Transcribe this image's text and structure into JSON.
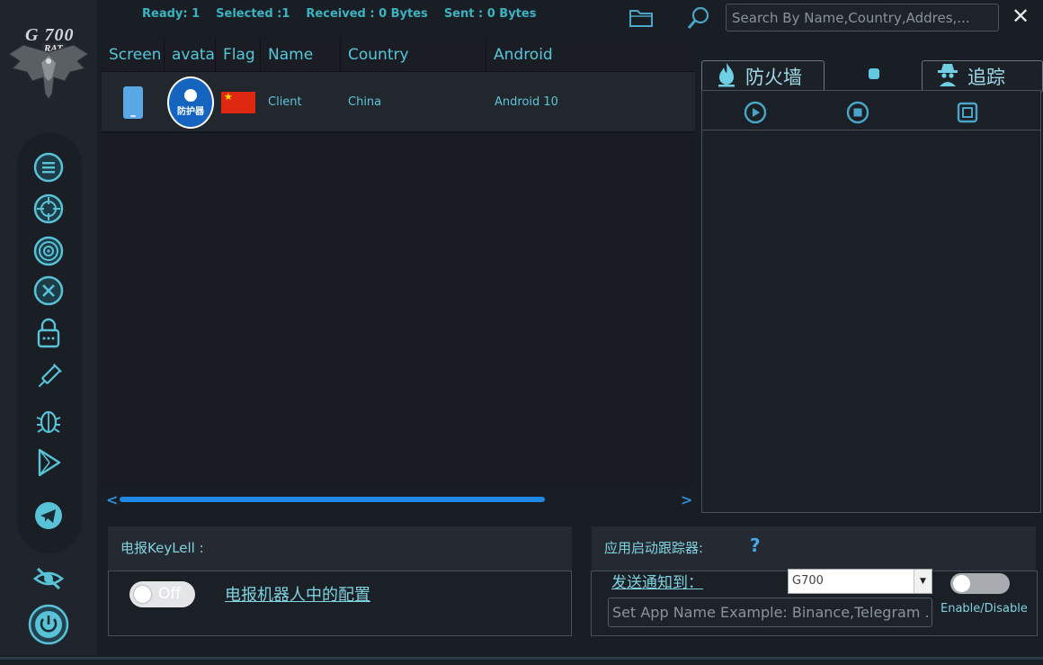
{
  "logo": {
    "title": "G 700",
    "subtitle": "RAT"
  },
  "status": {
    "ready": "Ready: 1",
    "selected": "Selected :1",
    "received": "Received : 0 Bytes",
    "sent": "Sent : 0 Bytes"
  },
  "search": {
    "placeholder": "Search By Name,Country,Addres,..."
  },
  "close_label": "✕",
  "table": {
    "columns": [
      "Screen",
      "avata",
      "Flag",
      "Name",
      "Country",
      "Android"
    ],
    "rows": [
      {
        "avatar_text": "防护器",
        "name": "Client",
        "country": "China",
        "android": "Android 10"
      }
    ]
  },
  "scroll": {
    "left": "<",
    "right": ">",
    "position": 0.0
  },
  "right_panel": {
    "firewall_label": "防火墙",
    "trace_label": "追踪"
  },
  "telegram_panel": {
    "title": "电报KeyLell :",
    "toggle_label": "Off",
    "config_link": "电报机器人中的配置"
  },
  "tracker_panel": {
    "title": "应用启动跟踪器:",
    "help": "?",
    "send_to_label": "发送通知到：",
    "select_value": "G700",
    "app_name_placeholder": "Set App Name Example: Binance,Telegram ...",
    "enable_label": "Enable/Disable"
  },
  "colors": {
    "accent": "#56c6d9",
    "scroll": "#1e88e5",
    "flag_red": "#de2910"
  }
}
